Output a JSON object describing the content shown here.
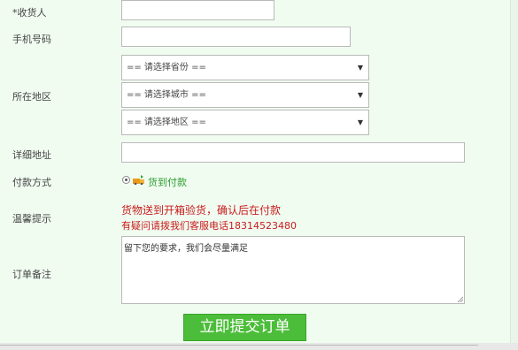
{
  "form": {
    "receiver": {
      "label": "*收货人",
      "value": ""
    },
    "phone": {
      "label": "手机号码",
      "value": ""
    },
    "region": {
      "label": "所在地区",
      "province": "== 请选择省份 ==",
      "city": "== 请选择城市 ==",
      "district": "== 请选择地区 =="
    },
    "address": {
      "label": "详细地址",
      "value": ""
    },
    "payment": {
      "label": "付款方式",
      "option": "货到付款",
      "icon": "cod-icon"
    },
    "tips": {
      "label": "温馨提示",
      "line1": "货物送到开箱验货，确认后在付款",
      "line2": "有疑问请拨我们客服电话18314523480"
    },
    "remark": {
      "label": "订单备注",
      "value": "留下您的要求，我们会尽量满足"
    },
    "submit_label": "立即提交订单"
  },
  "colors": {
    "background": "#f1fcf1",
    "accent": "#4cbd3a",
    "tip": "#c81c1c",
    "payment_text": "#2e9e2e"
  }
}
